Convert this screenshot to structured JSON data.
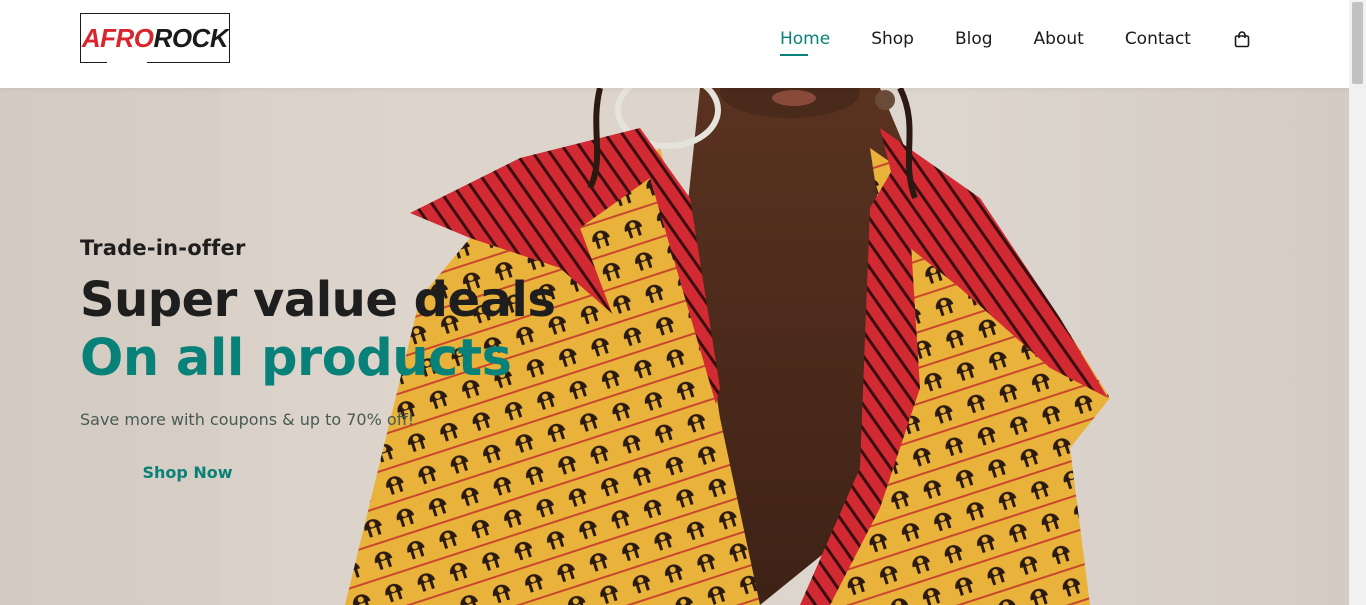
{
  "brand": {
    "logo_part1": "AFRO",
    "logo_part2": "ROCK"
  },
  "nav": {
    "items": [
      {
        "label": "Home",
        "active": true
      },
      {
        "label": "Shop",
        "active": false
      },
      {
        "label": "Blog",
        "active": false
      },
      {
        "label": "About",
        "active": false
      },
      {
        "label": "Contact",
        "active": false
      }
    ],
    "cart_icon": "shopping-bag-icon"
  },
  "hero": {
    "eyebrow": "Trade-in-offer",
    "headline_line1": "Super value deals",
    "headline_line2": "On all products",
    "subtext": "Save more with coupons & up to 70% off!",
    "cta_label": "Shop Now"
  },
  "colors": {
    "accent": "#088178",
    "logo_red": "#d9262e",
    "text_dark": "#1e1e1e",
    "hero_bg": "#ddd4cb"
  }
}
